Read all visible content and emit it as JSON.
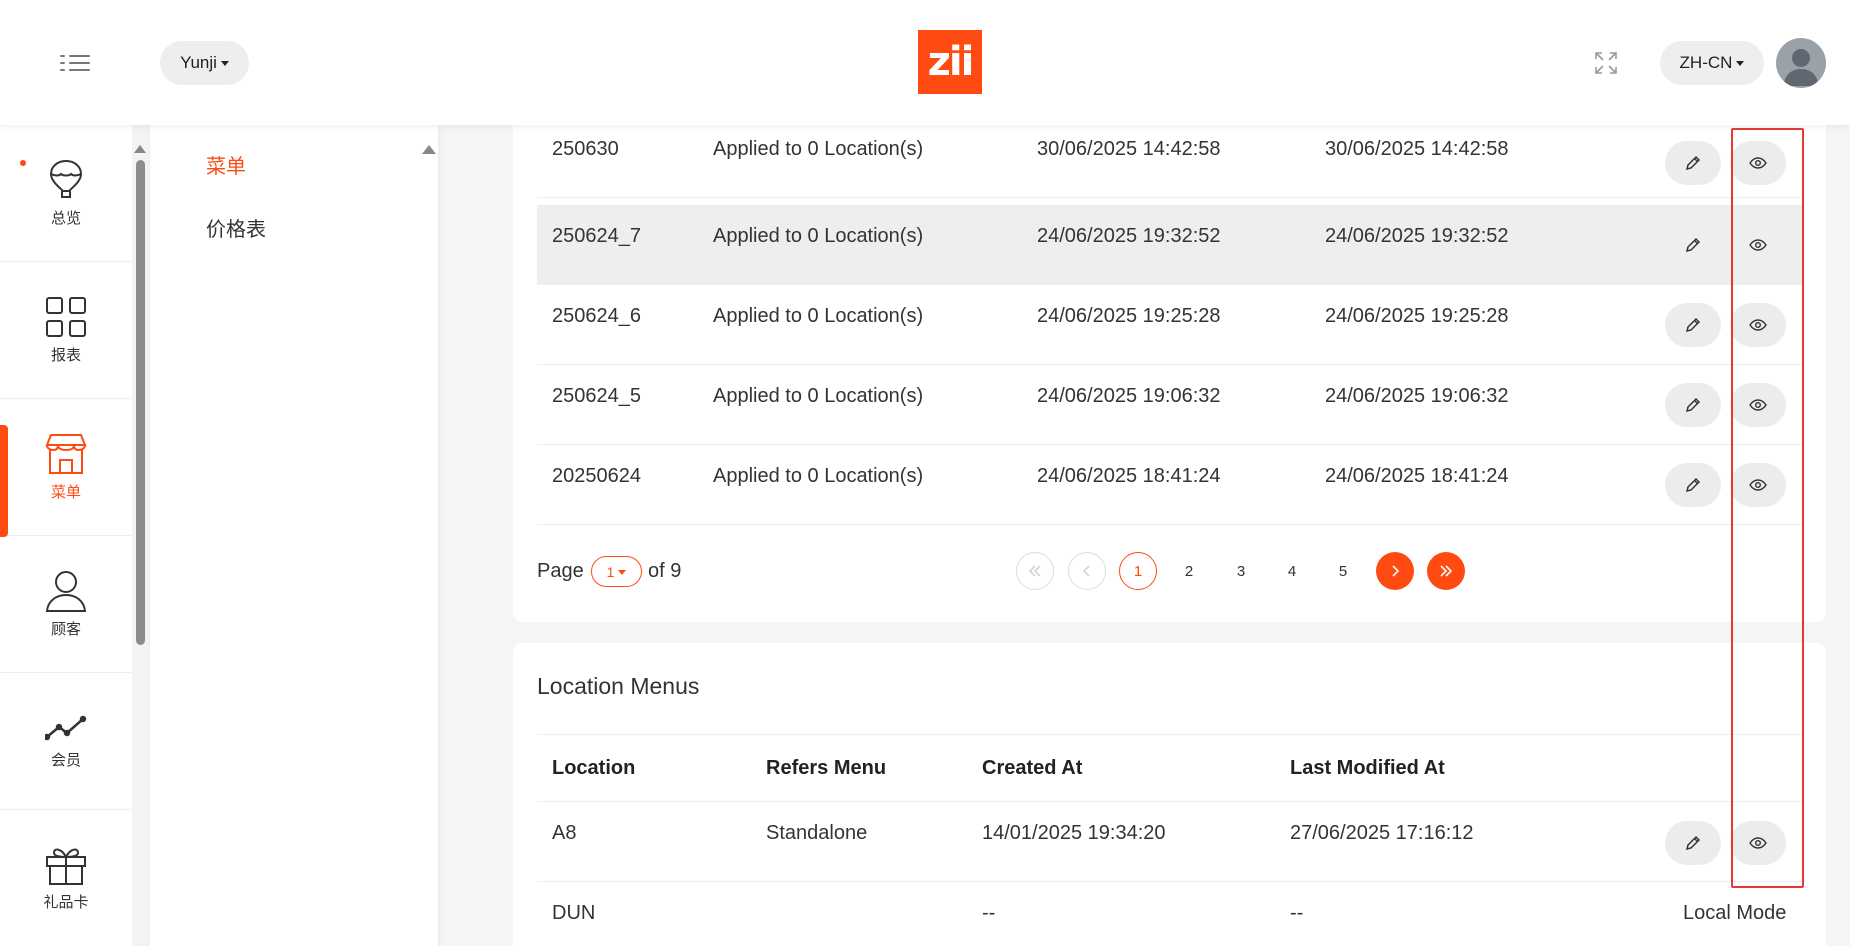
{
  "header": {
    "store_selector": "Yunji",
    "logo_text": "zii",
    "language_selector": "ZH-CN"
  },
  "sidebar": {
    "items": [
      {
        "label": "总览",
        "icon": "hot-air-balloon-icon"
      },
      {
        "label": "报表",
        "icon": "grid-icon"
      },
      {
        "label": "菜单",
        "icon": "storefront-icon",
        "active": true
      },
      {
        "label": "顾客",
        "icon": "person-icon"
      },
      {
        "label": "会员",
        "icon": "line-chart-icon"
      },
      {
        "label": "礼品卡",
        "icon": "gift-icon"
      }
    ]
  },
  "submenu": {
    "items": [
      {
        "label": "菜单",
        "active": true
      },
      {
        "label": "价格表"
      }
    ]
  },
  "menus_table": {
    "rows": [
      {
        "name": "250630",
        "applied": "Applied to 0 Location(s)",
        "created": "30/06/2025 14:42:58",
        "modified": "30/06/2025 14:42:58"
      },
      {
        "name": "250624_7",
        "applied": "Applied to 0 Location(s)",
        "created": "24/06/2025 19:32:52",
        "modified": "24/06/2025 19:32:52"
      },
      {
        "name": "250624_6",
        "applied": "Applied to 0 Location(s)",
        "created": "24/06/2025 19:25:28",
        "modified": "24/06/2025 19:25:28"
      },
      {
        "name": "250624_5",
        "applied": "Applied to 0 Location(s)",
        "created": "24/06/2025 19:06:32",
        "modified": "24/06/2025 19:06:32"
      },
      {
        "name": "20250624",
        "applied": "Applied to 0 Location(s)",
        "created": "24/06/2025 18:41:24",
        "modified": "24/06/2025 18:41:24"
      }
    ]
  },
  "pagination": {
    "page_label": "Page",
    "current_page": "1",
    "of_label": "of 9",
    "pages": [
      "1",
      "2",
      "3",
      "4",
      "5"
    ]
  },
  "location_menus": {
    "title": "Location Menus",
    "columns": {
      "location": "Location",
      "refers_menu": "Refers Menu",
      "created_at": "Created At",
      "last_modified_at": "Last Modified At"
    },
    "rows": [
      {
        "location": "A8",
        "refers_menu": "Standalone",
        "created": "14/01/2025 19:34:20",
        "modified": "27/06/2025 17:16:12",
        "mode": ""
      },
      {
        "location": "DUN",
        "refers_menu": "",
        "created": "--",
        "modified": "--",
        "mode": "Local Mode"
      }
    ]
  },
  "colors": {
    "accent": "#ff4a12",
    "highlight_box": "#e53935"
  }
}
